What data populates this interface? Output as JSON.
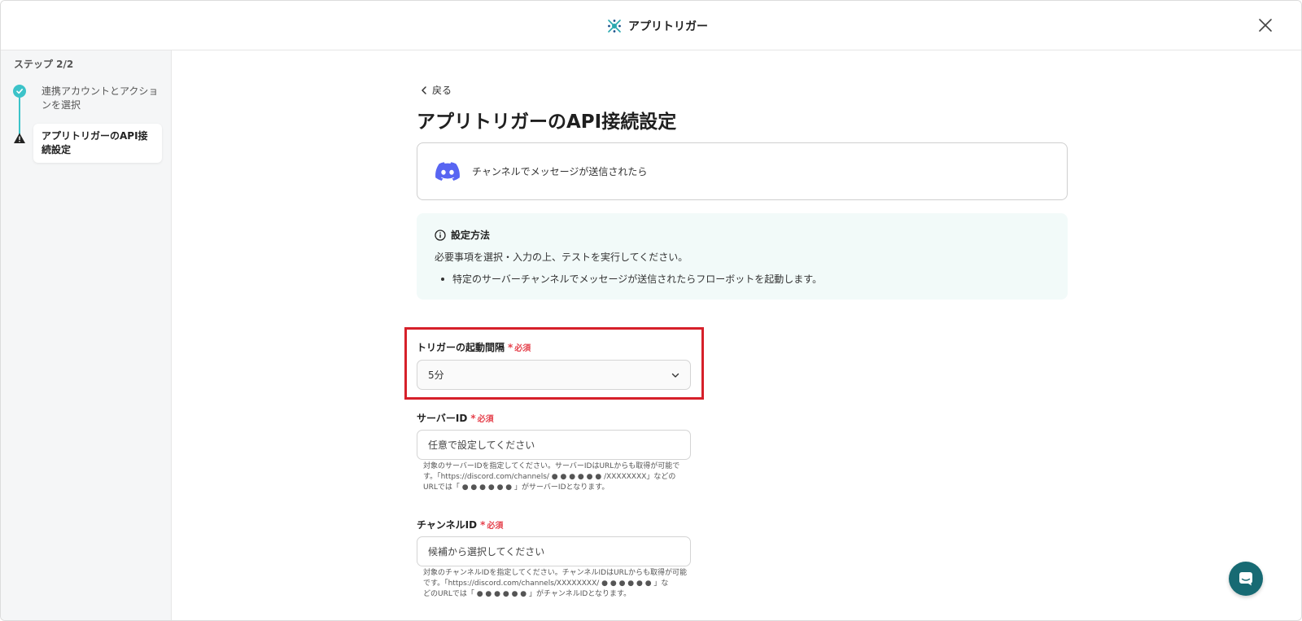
{
  "header": {
    "title": "アプリトリガー"
  },
  "sidebar": {
    "step_label": "ステップ 2/2",
    "steps": [
      {
        "label": "連携アカウントとアクションを選択",
        "status": "complete"
      },
      {
        "label": "アプリトリガーのAPI接続設定",
        "status": "warning"
      }
    ]
  },
  "main": {
    "back_label": "戻る",
    "page_title": "アプリトリガーのAPI接続設定",
    "trigger_card": {
      "app_icon": "discord-icon",
      "label": "チャンネルでメッセージが送信されたら"
    },
    "info": {
      "heading": "設定方法",
      "description": "必要事項を選択・入力の上、テストを実行してください。",
      "bullets": [
        "特定のサーバーチャンネルでメッセージが送信されたらフローボットを起動します。"
      ]
    },
    "required_mark": "*",
    "required_text": "必須",
    "fields": {
      "interval": {
        "label": "トリガーの起動間隔",
        "value": "5分"
      },
      "server_id": {
        "label": "サーバーID",
        "placeholder": "任意で設定してください",
        "help_line1": "対象のサーバーIDを指定してください。サーバーIDはURLからも取得が可能で",
        "help_line2": "す。「https://discord.com/channels/ ● ● ● ● ● ● /XXXXXXXX」などの",
        "help_line3": "URLでは「 ● ● ● ● ● ● 」がサーバーIDとなります。"
      },
      "channel_id": {
        "label": "チャンネルID",
        "placeholder": "候補から選択してください",
        "help_line1": "対象のチャンネルIDを指定してください。チャンネルIDはURLからも取得が可能",
        "help_line2": "です。「https://discord.com/channels/XXXXXXXX/ ● ● ● ● ● ● 」な",
        "help_line3": "どのURLでは「 ● ● ● ● ● ● 」がチャンネルIDとなります。"
      }
    }
  },
  "colors": {
    "accent_teal": "#3cc3c9",
    "highlight_red": "#d6202a",
    "required_red": "#e5414c",
    "discord": "#5865f2",
    "chat_button": "#176a73"
  }
}
